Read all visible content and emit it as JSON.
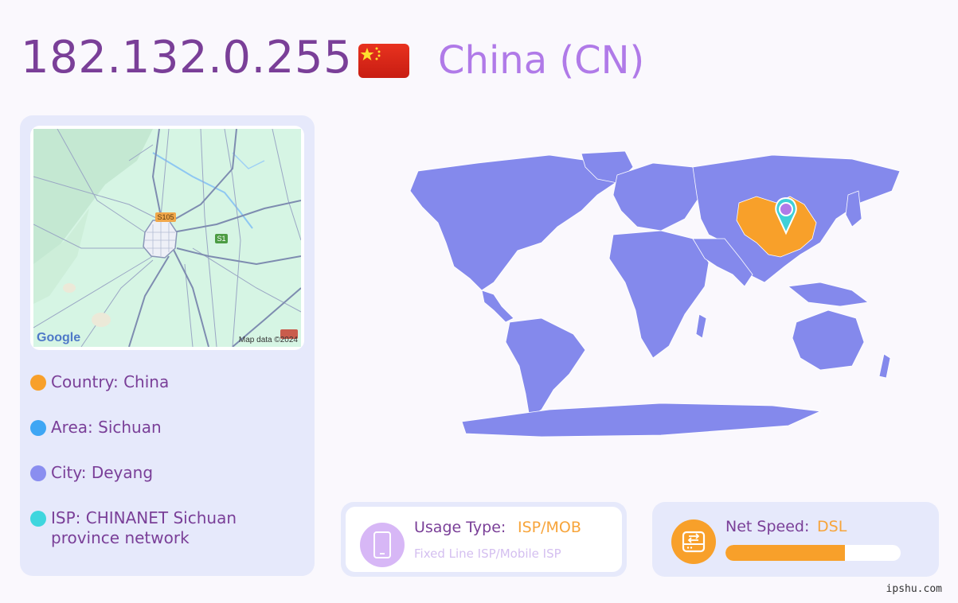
{
  "header": {
    "ip": "182.132.0.255",
    "country_title": "China (CN)"
  },
  "map": {
    "road_labels": [
      "S105",
      "S1"
    ],
    "google_label": "Google",
    "attribution": "Map data ©2024"
  },
  "info": {
    "country": "Country: China",
    "area": "Area: Sichuan",
    "city": "City: Deyang",
    "isp": "ISP: CHINANET Sichuan province network"
  },
  "usage": {
    "label": "Usage Type:",
    "value": "ISP/MOB",
    "description": "Fixed Line ISP/Mobile ISP"
  },
  "speed": {
    "label": "Net Speed:",
    "value": "DSL",
    "level": 0.68
  },
  "footer": {
    "site": "ipshu.com"
  },
  "colors": {
    "country_dot": "#f8a02a",
    "area_dot": "#3ea6f4",
    "city_dot": "#8a8ef0",
    "isp_dot": "#3fd6de",
    "highlight_country": "#f8a02a",
    "land": "#8489ec",
    "pin": "#3fd0d8"
  },
  "icons": {
    "usage": "mobile-phone-icon",
    "speed": "network-drive-icon",
    "location": "map-pin-icon"
  }
}
